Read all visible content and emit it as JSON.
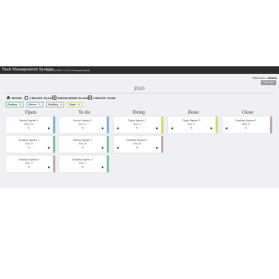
{
  "app": {
    "brand": "Task Management System",
    "nav": [
      "Edit Profile",
      "User Management"
    ],
    "welcome_label": "Welcome,",
    "user": "admin",
    "signout": "Sign Out"
  },
  "board": {
    "title": "ZOO"
  },
  "toolbar": {
    "home": "HOME",
    "create_plan": "CREATE PLAN",
    "show_hide_plans": "SHOW/HIDE PLANS",
    "create_task": "CREATE TASK"
  },
  "plans": [
    {
      "label": "Donkey",
      "color": "#6ec7a3"
    },
    {
      "label": "Horse",
      "color": "#7db3df"
    },
    {
      "label": "Monkey",
      "color": "#c9a3ad"
    },
    {
      "label": "Tiger",
      "color": "#cfe05a"
    }
  ],
  "columns": [
    {
      "name": "Open",
      "cards": [
        {
          "title": "Horse Sprint 1",
          "sub": "Zoo_10",
          "color": "#7db3df",
          "left": false,
          "right": true
        },
        {
          "title": "Donkey Sprint 2",
          "sub": "Zoo_6",
          "color": "#6ec7a3",
          "left": false,
          "right": true
        },
        {
          "title": "Monkey Sprint 3",
          "sub": "Zoo_9",
          "color": "#c9a3ad",
          "left": false,
          "right": true
        }
      ]
    },
    {
      "name": "To do",
      "cards": [
        {
          "title": "Horse Sprint 1",
          "sub": "Zoo_3",
          "color": "#7db3df",
          "left": false,
          "right": true
        },
        {
          "title": "Horse Sprint 2",
          "sub": "Zoo_8",
          "color": "#6ec7a3",
          "left": false,
          "right": true
        },
        {
          "title": "Donkey Sprint 1",
          "sub": "Zoo_7",
          "color": "#6ec7a3",
          "left": false,
          "right": true
        }
      ]
    },
    {
      "name": "Doing",
      "cards": [
        {
          "title": "Tiger Sprint 1",
          "sub": "Zoo_2",
          "color": "#cfe05a",
          "left": true,
          "right": true
        },
        {
          "title": "Monkey Sprint 2",
          "sub": "Zoo_4",
          "color": "#c9a3ad",
          "left": true,
          "right": true
        }
      ]
    },
    {
      "name": "Done",
      "cards": [
        {
          "title": "Tiger Sprint 1",
          "sub": "Zoo_1",
          "color": "#cfe05a",
          "left": true,
          "right": true
        }
      ]
    },
    {
      "name": "Close",
      "cards": [
        {
          "title": "Monkey Sprint 1",
          "sub": "Zoo_5",
          "color": "#c9a3ad",
          "left": true,
          "right": false
        }
      ]
    }
  ],
  "icons": {
    "edit": "edit-icon",
    "home": "home-icon",
    "plan": "refresh-icon",
    "show": "eye-icon",
    "task": "task-icon",
    "left": "arrow-left-icon",
    "right": "arrow-right-icon"
  }
}
